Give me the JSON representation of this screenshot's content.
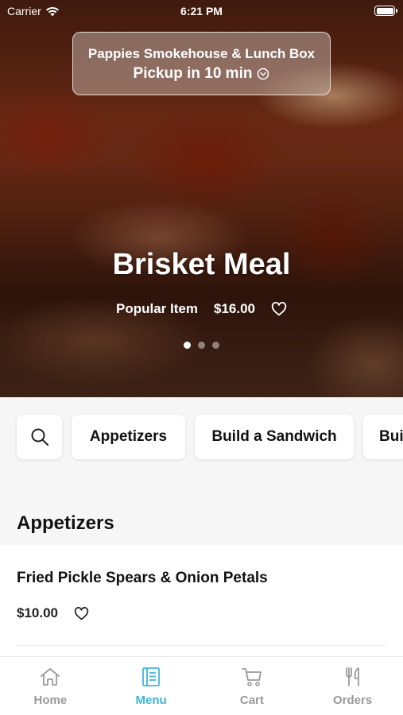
{
  "status_bar": {
    "carrier": "Carrier",
    "time": "6:21 PM"
  },
  "pickup": {
    "restaurant": "Pappies Smokehouse & Lunch Box",
    "time_label": "Pickup in 10 min"
  },
  "hero": {
    "title": "Brisket Meal",
    "tag": "Popular Item",
    "price": "$16.00",
    "slide_count": 3,
    "active_slide": 1
  },
  "categories": {
    "search_icon": "search-icon",
    "items": [
      {
        "label": "Appetizers"
      },
      {
        "label": "Build a Sandwich"
      },
      {
        "label": "Build a Sandwich"
      }
    ]
  },
  "section": {
    "title": "Appetizers"
  },
  "menu_items": [
    {
      "name": "Fried Pickle Spears & Onion Petals",
      "price": "$10.00"
    }
  ],
  "tab_bar": {
    "accent_color": "#3fb4d8",
    "inactive_color": "#9a9a9a",
    "tabs": [
      {
        "label": "Home",
        "icon": "home-icon",
        "active": false
      },
      {
        "label": "Menu",
        "icon": "menu-icon",
        "active": true
      },
      {
        "label": "Cart",
        "icon": "cart-icon",
        "active": false
      },
      {
        "label": "Orders",
        "icon": "orders-icon",
        "active": false
      }
    ]
  }
}
